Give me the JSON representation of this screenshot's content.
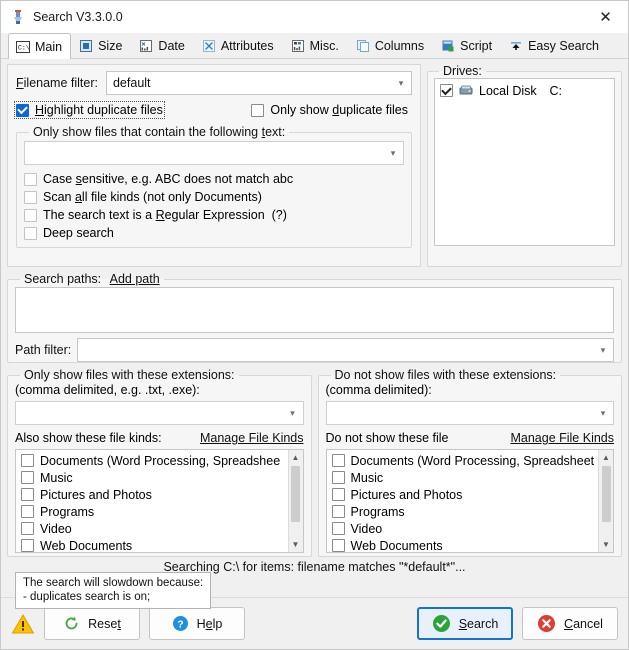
{
  "window": {
    "title": "Search V3.3.0.0",
    "app_icon": "search-app-icon",
    "close_label": "✕"
  },
  "tabs": [
    {
      "label": "Main",
      "icon": "console-icon",
      "active": true
    },
    {
      "label": "Size",
      "icon": "size-icon",
      "active": false
    },
    {
      "label": "Date",
      "icon": "date-chart-icon",
      "active": false
    },
    {
      "label": "Attributes",
      "icon": "attributes-icon",
      "active": false
    },
    {
      "label": "Misc.",
      "icon": "misc-chart-icon",
      "active": false
    },
    {
      "label": "Columns",
      "icon": "columns-icon",
      "active": false
    },
    {
      "label": "Script",
      "icon": "script-icon",
      "active": false
    },
    {
      "label": "Easy Search",
      "icon": "easy-search-icon",
      "active": false
    }
  ],
  "main": {
    "filename_filter_label": "Filename filter:",
    "filename_filter_value": "default",
    "filename_filter_placeholder": "",
    "highlight_duplicates_label": "Highlight duplicate files",
    "highlight_duplicates_checked": true,
    "only_duplicates_label": "Only show duplicate files",
    "only_duplicates_checked": false,
    "contains_text_legend": "Only show files that contain the following text:",
    "contains_text_value": "",
    "contains_text_placeholder": "",
    "options": [
      {
        "label": "Case sensitive, e.g. ABC does not match abc",
        "checked": false,
        "disabled": true
      },
      {
        "label": "Scan all file kinds (not only Documents)",
        "checked": false,
        "disabled": true
      },
      {
        "label": "The search text is a Regular Expression  (?)",
        "checked": false,
        "disabled": true
      },
      {
        "label": "Deep search",
        "checked": false,
        "disabled": true
      }
    ]
  },
  "drives": {
    "legend": "Drives:",
    "items": [
      {
        "name": "Local Disk",
        "letter": "C:",
        "checked": true,
        "icon": "hard-disk-icon"
      }
    ]
  },
  "search_paths": {
    "legend": "Search paths:",
    "add_path_link": "Add path",
    "list_items": [],
    "path_filter_label": "Path filter:",
    "path_filter_value": "",
    "path_filter_placeholder": ""
  },
  "include_ext": {
    "legend": "Only show files with these extensions:",
    "sub_label": "(comma delimited, e.g. .txt, .exe):",
    "value": "",
    "placeholder": "",
    "kinds_label": "Also show these file kinds:",
    "manage_link": "Manage File Kinds",
    "kinds": [
      {
        "label": "Documents (Word Processing, Spreadshee",
        "checked": false
      },
      {
        "label": "Music",
        "checked": false
      },
      {
        "label": "Pictures and Photos",
        "checked": false
      },
      {
        "label": "Programs",
        "checked": false
      },
      {
        "label": "Video",
        "checked": false
      },
      {
        "label": "Web Documents",
        "checked": false
      }
    ]
  },
  "exclude_ext": {
    "legend": "Do not show files with these extensions:",
    "sub_label": "(comma delimited):",
    "value": "",
    "placeholder": "",
    "kinds_label": "Do not show these file",
    "manage_link": "Manage File Kinds",
    "kinds": [
      {
        "label": "Documents (Word Processing, Spreadsheet",
        "checked": false
      },
      {
        "label": "Music",
        "checked": false
      },
      {
        "label": "Pictures and Photos",
        "checked": false
      },
      {
        "label": "Programs",
        "checked": false
      },
      {
        "label": "Video",
        "checked": false
      },
      {
        "label": "Web Documents",
        "checked": false
      }
    ]
  },
  "status": {
    "text": "Searching C:\\ for items: filename matches \"*default*\"..."
  },
  "tooltip": {
    "line1": "The search will slowdown because:",
    "line2": "- duplicates search is on;"
  },
  "footer": {
    "warning_icon": "warning-triangle-icon",
    "reset_label": "Reset",
    "reset_icon": "refresh-icon",
    "help_label": "Help",
    "help_icon": "question-circle-icon",
    "search_label": "Search",
    "search_icon": "check-circle-icon",
    "cancel_label": "Cancel",
    "cancel_icon": "x-circle-icon"
  },
  "colors": {
    "accent": "#0a68d8",
    "primary_border": "#1274cd",
    "success": "#2aa33a",
    "danger": "#e23b35",
    "warning": "#ffc000",
    "help_blue": "#1e90e0",
    "window_bg": "#f0f0f0",
    "panel_bg": "#f6f6f6"
  }
}
